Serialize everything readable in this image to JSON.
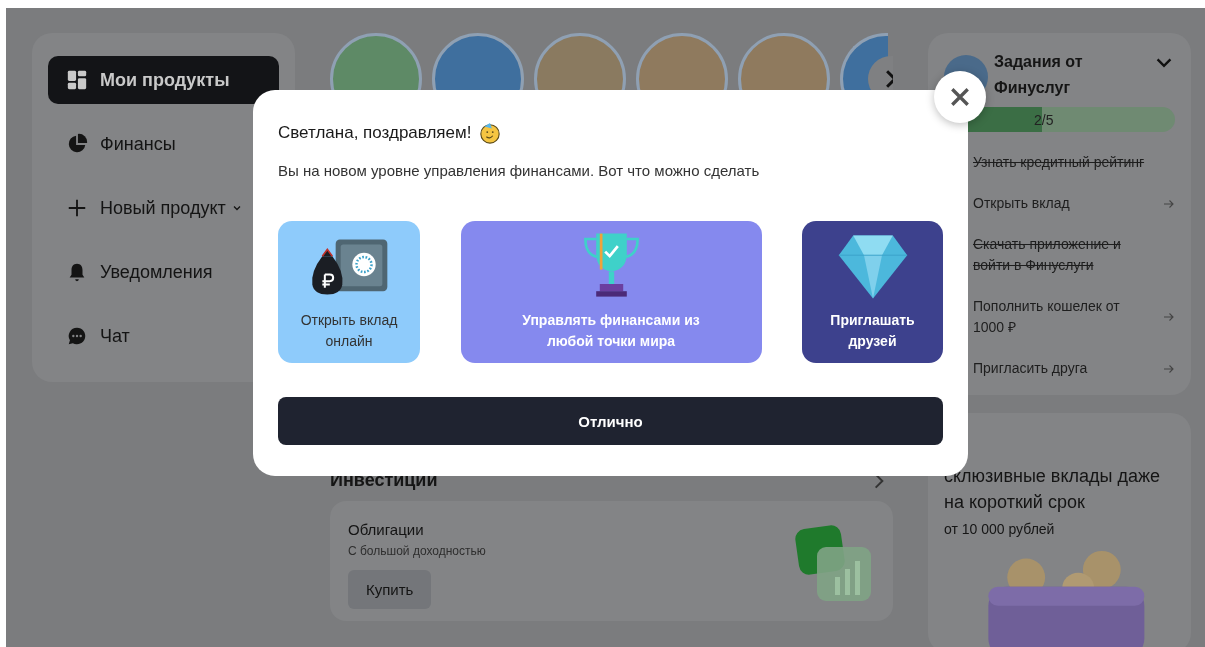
{
  "sidebar": {
    "items": [
      {
        "label": "Мои продукты",
        "kind": "grid",
        "selected": true,
        "has_dropdown": false
      },
      {
        "label": "Финансы",
        "kind": "pie",
        "selected": false,
        "has_dropdown": false
      },
      {
        "label": "Новый продукт",
        "kind": "plus",
        "selected": false,
        "has_dropdown": true
      },
      {
        "label": "Уведомления",
        "kind": "bell",
        "selected": false,
        "has_dropdown": false
      },
      {
        "label": "Чат",
        "kind": "chat",
        "selected": false,
        "has_dropdown": false
      }
    ]
  },
  "stories": [
    {
      "color": "#5e8a66"
    },
    {
      "color": "#3f6f9e"
    },
    {
      "color": "#8a7a60"
    },
    {
      "color": "#8f7a5e"
    },
    {
      "color": "#8f7a5e"
    },
    {
      "color": "#3f6f9e"
    }
  ],
  "investments": {
    "title": "Инвестиции",
    "card": {
      "title": "Облигации",
      "subtitle": "С большой доходностью",
      "button": "Купить"
    }
  },
  "tasks": {
    "title": "Задания от Финуслуг",
    "progress": {
      "level": 0.4,
      "label": "2/5"
    },
    "items": [
      {
        "label": "Узнать кредитный рейтинг",
        "done": true
      },
      {
        "label": "Открыть вклад",
        "done": false
      },
      {
        "label": "Скачать приложение и войти в Финуслуги",
        "done": true
      },
      {
        "label": "Пополнить кошелек от 1000 ₽",
        "done": false
      },
      {
        "label": "Пригласить друга",
        "done": false
      }
    ]
  },
  "promo": {
    "title": "склюзивные вклады даже на короткий срок",
    "subtitle": "от 10 000 рублей"
  },
  "modal": {
    "title": "Светлана, поздравляем!",
    "text": "Вы на новом уровне управления финансами. Вот что можно сделать",
    "cards": [
      {
        "kind": "safe",
        "label": "Открыть вклад онлайн",
        "color": "#8ecbfb"
      },
      {
        "kind": "trophy",
        "label": "Управлять финансами из любой точки мира",
        "color": "#8589ee"
      },
      {
        "kind": "diamond",
        "label": "Приглашать друзей",
        "color": "#3d418d"
      }
    ],
    "button": "Отлично"
  }
}
